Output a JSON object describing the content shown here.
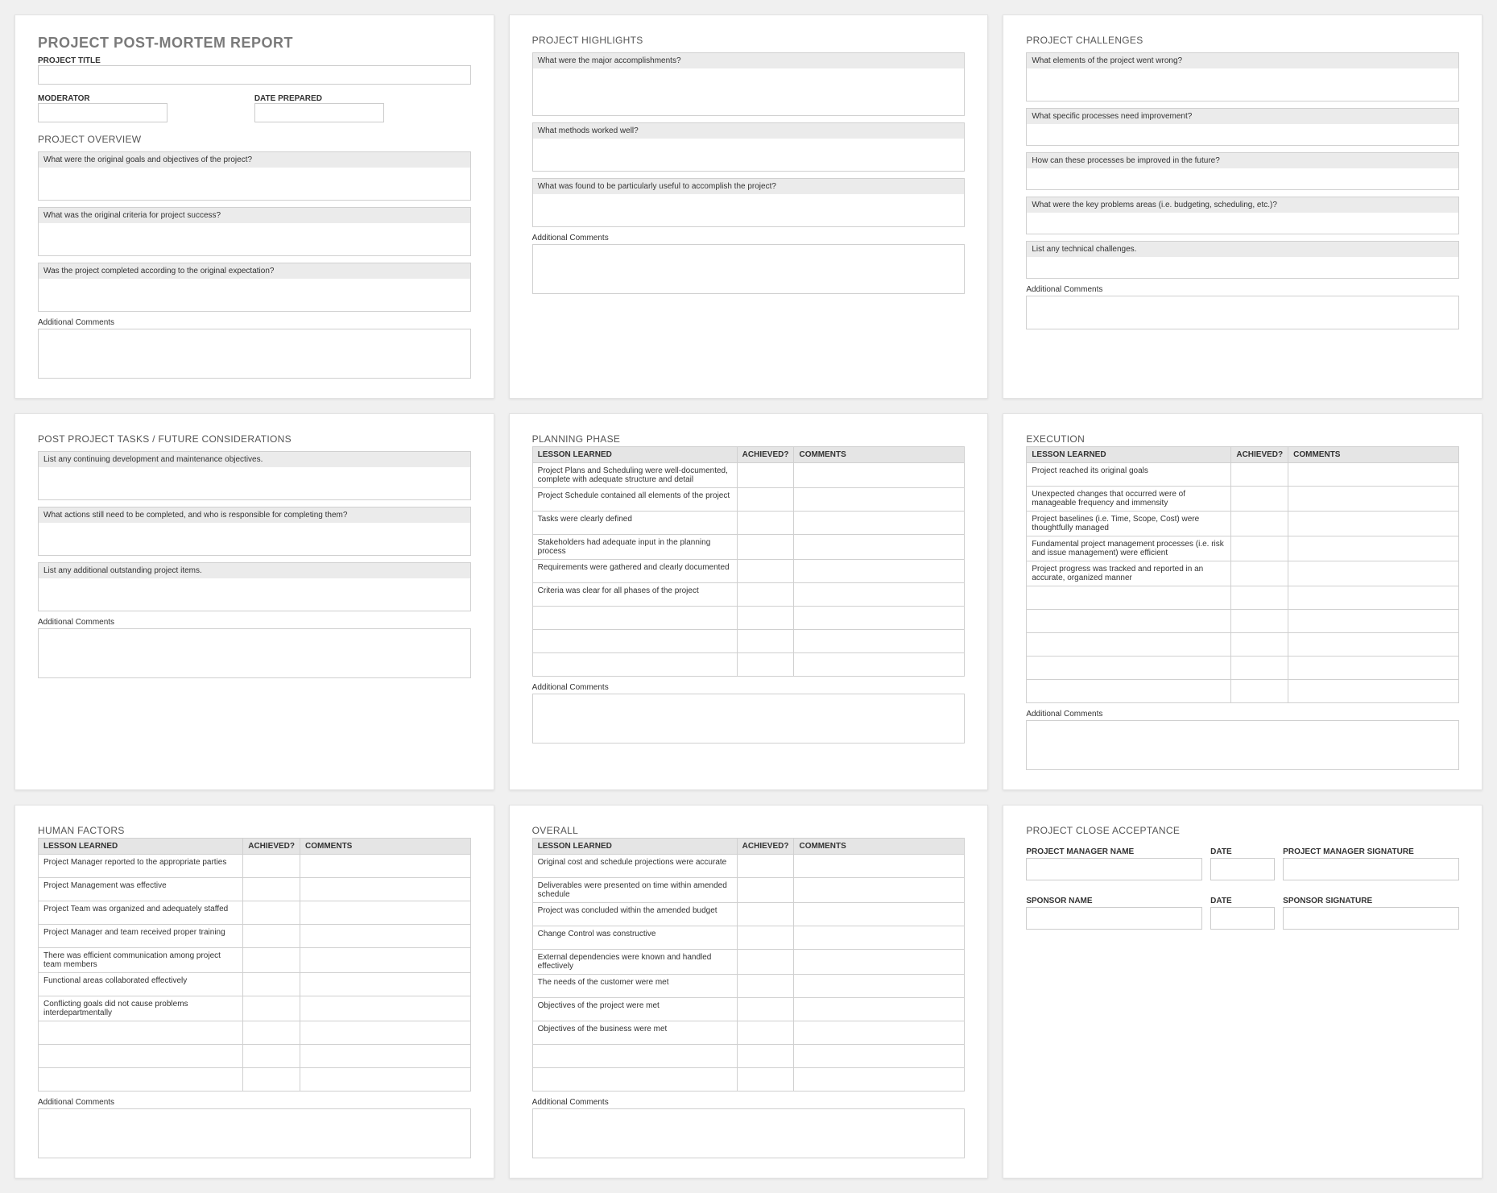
{
  "report": {
    "title": "PROJECT POST-MORTEM REPORT",
    "project_title_label": "PROJECT TITLE",
    "moderator_label": "MODERATOR",
    "date_prepared_label": "DATE PREPARED"
  },
  "overview": {
    "title": "PROJECT OVERVIEW",
    "q1": "What were the original goals and objectives of the project?",
    "q2": "What was the original criteria for project success?",
    "q3": "Was the project completed according to the original expectation?",
    "comments_label": "Additional Comments"
  },
  "highlights": {
    "title": "PROJECT HIGHLIGHTS",
    "q1": "What were the major accomplishments?",
    "q2": "What methods worked well?",
    "q3": "What was found to be particularly useful to accomplish the project?",
    "comments_label": "Additional Comments"
  },
  "challenges": {
    "title": "PROJECT CHALLENGES",
    "q1": "What elements of the project went wrong?",
    "q2": "What specific processes need improvement?",
    "q3": "How can these processes be improved in the future?",
    "q4": "What were the key problems areas (i.e. budgeting, scheduling, etc.)?",
    "q5": "List any technical challenges.",
    "comments_label": "Additional Comments"
  },
  "postproject": {
    "title": "POST PROJECT TASKS / FUTURE CONSIDERATIONS",
    "q1": "List any continuing development and maintenance objectives.",
    "q2": "What actions still need to be completed, and who is responsible for completing them?",
    "q3": "List any additional outstanding project items.",
    "comments_label": "Additional Comments"
  },
  "planning": {
    "title": "PLANNING PHASE",
    "th1": "LESSON LEARNED",
    "th2": "ACHIEVED?",
    "th3": "COMMENTS",
    "rows": [
      "Project Plans and Scheduling were well-documented, complete with adequate structure and detail",
      "Project Schedule contained all elements of the project",
      "Tasks were clearly defined",
      "Stakeholders had adequate input in the planning process",
      "Requirements were gathered and clearly documented",
      "Criteria was clear for all phases of the project",
      "",
      "",
      ""
    ],
    "comments_label": "Additional Comments"
  },
  "execution": {
    "title": "EXECUTION",
    "th1": "LESSON LEARNED",
    "th2": "ACHIEVED?",
    "th3": "COMMENTS",
    "rows": [
      "Project reached its original goals",
      "Unexpected changes that occurred were of manageable frequency and immensity",
      "Project baselines (i.e. Time, Scope, Cost) were thoughtfully managed",
      "Fundamental project management processes (i.e. risk and issue management) were efficient",
      "Project progress was tracked and reported in an accurate, organized manner",
      "",
      "",
      "",
      "",
      ""
    ],
    "comments_label": "Additional Comments"
  },
  "human": {
    "title": "HUMAN FACTORS",
    "th1": "LESSON LEARNED",
    "th2": "ACHIEVED?",
    "th3": "COMMENTS",
    "rows": [
      "Project Manager reported to the appropriate parties",
      "Project Management was effective",
      "Project Team was organized and adequately staffed",
      "Project Manager and team received proper training",
      "There was efficient communication among project team members",
      "Functional areas collaborated effectively",
      "Conflicting goals did not cause problems interdepartmentally",
      "",
      "",
      ""
    ],
    "comments_label": "Additional Comments"
  },
  "overall": {
    "title": "OVERALL",
    "th1": "LESSON LEARNED",
    "th2": "ACHIEVED?",
    "th3": "COMMENTS",
    "rows": [
      "Original cost and schedule projections were accurate",
      "Deliverables were presented on time within amended schedule",
      "Project was concluded within the amended budget",
      "Change Control was constructive",
      "External dependencies were known and handled effectively",
      "The needs of the customer were met",
      "Objectives of the project were met",
      "Objectives of the business were met",
      "",
      ""
    ],
    "comments_label": "Additional Comments"
  },
  "close": {
    "title": "PROJECT CLOSE ACCEPTANCE",
    "pm_name": "PROJECT MANAGER NAME",
    "date": "DATE",
    "pm_sig": "PROJECT MANAGER SIGNATURE",
    "sponsor_name": "SPONSOR NAME",
    "sponsor_sig": "SPONSOR SIGNATURE"
  }
}
